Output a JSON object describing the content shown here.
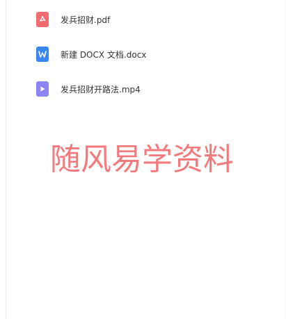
{
  "files": [
    {
      "name": "发兵招财.pdf",
      "icon": "pdf-icon",
      "icon_color": "#f46b6f"
    },
    {
      "name": "新建 DOCX 文档.docx",
      "icon": "word-icon",
      "icon_color": "#3a86f0"
    },
    {
      "name": "发兵招财开路法.mp4",
      "icon": "video-icon",
      "icon_color": "#8b84f6"
    }
  ],
  "watermark": "随风易学资料"
}
